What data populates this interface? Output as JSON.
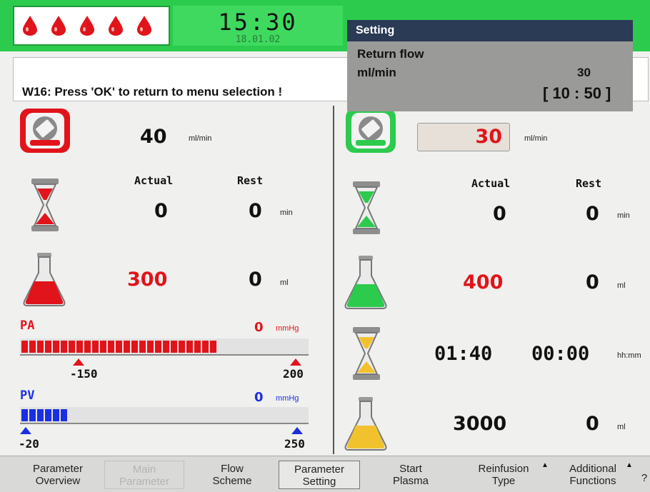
{
  "header": {
    "time": "15:30",
    "date": "18.01.02",
    "drop_icon": "blood-drop-icon",
    "drop_count": 5
  },
  "message": "W16: Press 'OK' to return to menu selection !",
  "popup": {
    "title": "Setting",
    "label": "Return flow",
    "unit": "ml/min",
    "value": "30",
    "range": "[ 10 : 50 ]"
  },
  "left": {
    "pump": {
      "icon": "pump-icon",
      "value": "40",
      "unit": "ml/min"
    },
    "headers": {
      "actual": "Actual",
      "rest": "Rest"
    },
    "time_row": {
      "icon": "hourglass-icon",
      "actual": "0",
      "rest": "0",
      "unit": "min"
    },
    "volume_row": {
      "icon": "flask-icon",
      "actual": "300",
      "rest": "0",
      "unit": "ml"
    },
    "pa": {
      "label": "PA",
      "value": "0",
      "unit": "mmHg",
      "min": "-150",
      "max": "200",
      "level": 0.68,
      "color": "#e0141a"
    },
    "pv": {
      "label": "PV",
      "value": "0",
      "unit": "mmHg",
      "min": "-20",
      "max": "250",
      "level": 0.17,
      "color": "#1a2fe0"
    }
  },
  "right": {
    "pump": {
      "icon": "pump-icon",
      "value": "30",
      "unit": "ml/min"
    },
    "headers": {
      "actual": "Actual",
      "rest": "Rest"
    },
    "time_row": {
      "icon": "hourglass-icon",
      "actual": "0",
      "rest": "0",
      "unit": "min"
    },
    "volume_row": {
      "icon": "flask-icon",
      "actual": "400",
      "rest": "0",
      "unit": "ml"
    },
    "time2_row": {
      "icon": "hourglass-icon",
      "actual": "01:40",
      "rest": "00:00",
      "unit": "hh:mm"
    },
    "volume2_row": {
      "icon": "flask-icon",
      "actual": "3000",
      "rest": "0",
      "unit": "ml"
    }
  },
  "nav": {
    "parameter_overview": "Parameter\nOverview",
    "main_parameter": "Main\nParameter",
    "flow_scheme": "Flow\nScheme",
    "parameter_setting": "Parameter\nSetting",
    "start_plasma": "Start\nPlasma",
    "reinfusion_type": "Reinfusion\nType",
    "additional_functions": "Additional\nFunctions",
    "help": "?"
  },
  "colors": {
    "green": "#2ccb4d",
    "red": "#e0141a",
    "blue": "#1a2fe0",
    "yellow": "#f2c22e"
  }
}
